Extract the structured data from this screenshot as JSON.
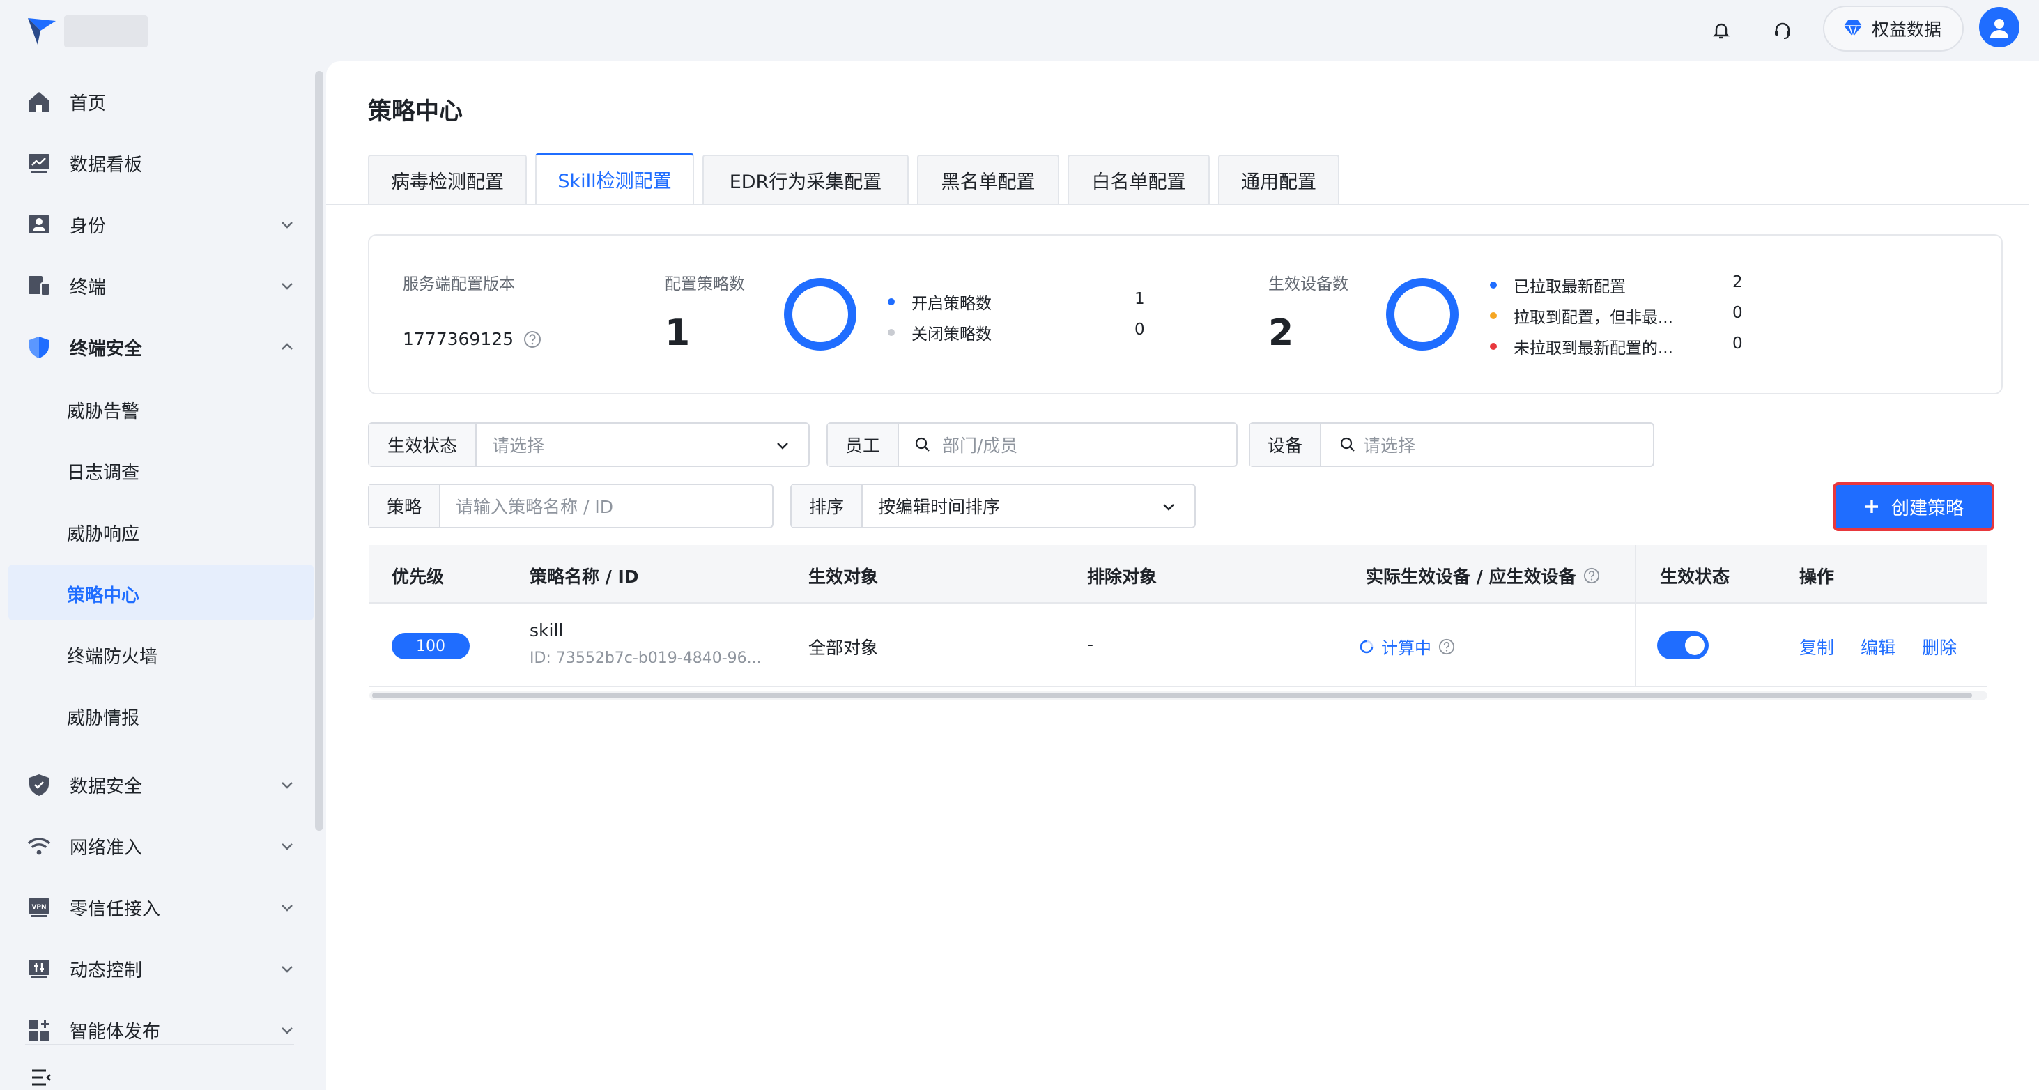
{
  "topbar": {
    "rights_label": "权益数据",
    "icons": [
      "bell-icon",
      "headset-icon",
      "diamond-icon",
      "user-icon"
    ]
  },
  "sidebar": {
    "items": [
      {
        "label": "首页",
        "icon": "home-icon"
      },
      {
        "label": "数据看板",
        "icon": "dashboard-icon"
      },
      {
        "label": "身份",
        "icon": "id-card-icon"
      },
      {
        "label": "终端",
        "icon": "devices-icon"
      },
      {
        "label": "终端安全",
        "icon": "shield-icon"
      },
      {
        "label": "数据安全",
        "icon": "data-shield-icon"
      },
      {
        "label": "网络准入",
        "icon": "wifi-icon"
      },
      {
        "label": "零信任接入",
        "icon": "vpn-icon"
      },
      {
        "label": "动态控制",
        "icon": "control-icon"
      },
      {
        "label": "智能体发布",
        "icon": "apps-icon"
      }
    ],
    "subitems": [
      "威胁告警",
      "日志调查",
      "威胁响应",
      "策略中心",
      "终端防火墙",
      "威胁情报"
    ],
    "active_subitem": "策略中心"
  },
  "page": {
    "title": "策略中心",
    "tabs": [
      "病毒检测配置",
      "Skill检测配置",
      "EDR行为采集配置",
      "黑名单配置",
      "白名单配置",
      "通用配置"
    ],
    "active_tab": "Skill检测配置"
  },
  "stats": {
    "version_label": "服务端配置版本",
    "version_value": "1777369125",
    "policy_label": "配置策略数",
    "policy_count": "1",
    "policy_legend": [
      {
        "label": "开启策略数",
        "value": "1",
        "color": "#1f6dff"
      },
      {
        "label": "关闭策略数",
        "value": "0",
        "color": "#c9ccd2"
      }
    ],
    "device_label": "生效设备数",
    "device_count": "2",
    "device_legend": [
      {
        "label": "已拉取最新配置",
        "value": "2",
        "color": "#1f6dff"
      },
      {
        "label": "拉取到配置，但非最...",
        "value": "0",
        "color": "#f5a623"
      },
      {
        "label": "未拉取到最新配置的...",
        "value": "0",
        "color": "#e8383d"
      }
    ]
  },
  "filters": {
    "status_label": "生效状态",
    "status_placeholder": "请选择",
    "employee_label": "员工",
    "employee_placeholder": "部门/成员",
    "device_label": "设备",
    "device_placeholder": "请选择",
    "policy_label": "策略",
    "policy_placeholder": "请输入策略名称 / ID",
    "sort_label": "排序",
    "sort_value": "按编辑时间排序"
  },
  "create_button": "创建策略",
  "table": {
    "headers": [
      "优先级",
      "策略名称 / ID",
      "生效对象",
      "排除对象",
      "实际生效设备 / 应生效设备",
      "生效状态",
      "操作"
    ],
    "rows": [
      {
        "priority": "100",
        "name": "skill",
        "id": "ID: 73552b7c-b019-4840-96...",
        "target": "全部对象",
        "exclude": "-",
        "devices": "计算中",
        "enabled": true,
        "actions": [
          "复制",
          "编辑",
          "删除"
        ]
      }
    ]
  }
}
